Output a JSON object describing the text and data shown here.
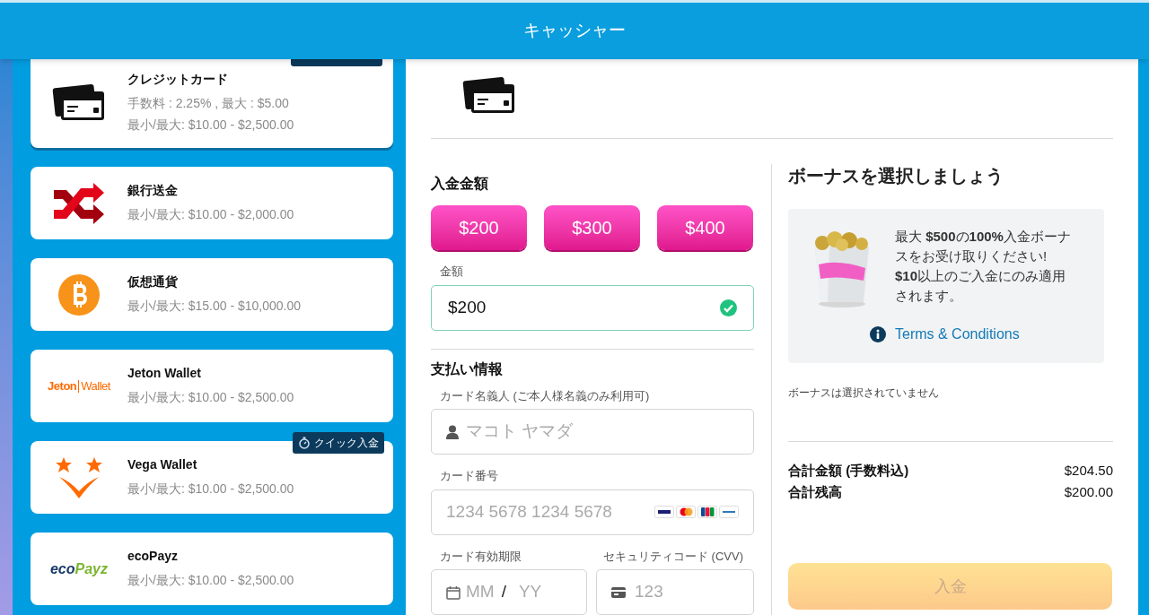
{
  "header": {
    "title": "キャッシャー"
  },
  "methods": [
    {
      "kind": "card",
      "title": "クレジットカード",
      "lines": [
        "手数料 : 2.25% , 最大 : $5.00",
        "最小/最大: $10.00 - $2,500.00"
      ],
      "selected": true,
      "quick_deposit": true
    },
    {
      "kind": "bank",
      "title": "銀行送金",
      "lines": [
        "最小/最大: $10.00 - $2,000.00"
      ],
      "selected": false,
      "quick_deposit": false
    },
    {
      "kind": "bitcoin",
      "title": "仮想通貨",
      "lines": [
        "最小/最大: $15.00 - $10,000.00"
      ],
      "selected": false,
      "quick_deposit": false
    },
    {
      "kind": "jeton",
      "logo_text": [
        "Jeton",
        "Wallet"
      ],
      "title": "Jeton Wallet",
      "lines": [
        "最小/最大: $10.00 - $2,500.00"
      ],
      "selected": false,
      "quick_deposit": false
    },
    {
      "kind": "vega",
      "title": "Vega Wallet",
      "lines": [
        "最小/最大: $10.00 - $2,500.00"
      ],
      "selected": false,
      "quick_deposit": true
    },
    {
      "kind": "ecopayz",
      "logo_text": [
        "eco",
        "Payz"
      ],
      "title": "ecoPayz",
      "lines": [
        "最小/最大: $10.00 - $2,500.00"
      ],
      "selected": false,
      "quick_deposit": false
    }
  ],
  "quick_deposit_label": "クイック入金",
  "deposit": {
    "heading": "入金金額",
    "presets": [
      "$200",
      "$300",
      "$400"
    ],
    "amount": {
      "label": "金額",
      "value": "$200",
      "valid": true
    }
  },
  "payment": {
    "heading": "支払い情報",
    "holder": {
      "label": "カード名義人 (ご本人様名義のみ利用可)",
      "placeholder": "マコト ヤマダ"
    },
    "number": {
      "label": "カード番号",
      "placeholder": "1234 5678 1234 5678"
    },
    "expiry": {
      "label": "カード有効期限",
      "month_placeholder": "MM",
      "separator": "/",
      "year_placeholder": "YY"
    },
    "cvv": {
      "label": "セキュリティコード (CVV)",
      "placeholder": "123"
    }
  },
  "bonus": {
    "heading": "ボーナスを選択しましょう",
    "offer": "最大 **$500**の**100%**入金ボーナスをお受け取りください! **$10**以上のご入金にのみ適用されます。",
    "terms": "Terms & Conditions",
    "status": "ボーナスは選択されていません"
  },
  "totals": [
    {
      "label": "合計金額 (手数料込)",
      "value": "$204.50"
    },
    {
      "label": "合計残高",
      "value": "$200.00"
    }
  ],
  "submit": {
    "label": "入金",
    "disabled": true
  }
}
